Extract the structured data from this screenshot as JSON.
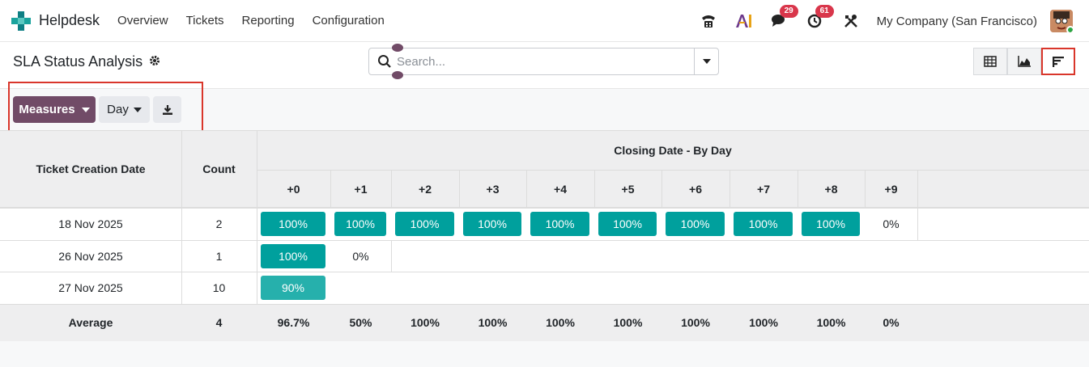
{
  "navbar": {
    "app_name": "Helpdesk",
    "menu": [
      "Overview",
      "Tickets",
      "Reporting",
      "Configuration"
    ],
    "messages_badge": "29",
    "activities_badge": "61",
    "company": "My Company (San Francisco)"
  },
  "control": {
    "title": "SLA Status Analysis",
    "search_placeholder": "Search..."
  },
  "toolbar": {
    "measures_label": "Measures",
    "day_label": "Day"
  },
  "table": {
    "col_creation": "Ticket Creation Date",
    "col_count": "Count",
    "group_header": "Closing Date - By Day",
    "offsets": [
      "+0",
      "+1",
      "+2",
      "+3",
      "+4",
      "+5",
      "+6",
      "+7",
      "+8",
      "+9"
    ],
    "rows": [
      {
        "date": "18 Nov 2025",
        "count": "2",
        "cells": [
          "100%",
          "100%",
          "100%",
          "100%",
          "100%",
          "100%",
          "100%",
          "100%",
          "100%",
          "0%"
        ]
      },
      {
        "date": "26 Nov 2025",
        "count": "1",
        "cells": [
          "100%",
          "0%"
        ]
      },
      {
        "date": "27 Nov 2025",
        "count": "10",
        "cells": [
          "90%"
        ]
      }
    ],
    "average": {
      "label": "Average",
      "count": "4",
      "cells": [
        "96.7%",
        "50%",
        "100%",
        "100%",
        "100%",
        "100%",
        "100%",
        "100%",
        "100%",
        "0%"
      ]
    }
  },
  "colors": {
    "brand": "#714b67",
    "pill_full": "#00a09d",
    "pill_partial": "#26b0ac",
    "highlight": "#d9362b"
  }
}
